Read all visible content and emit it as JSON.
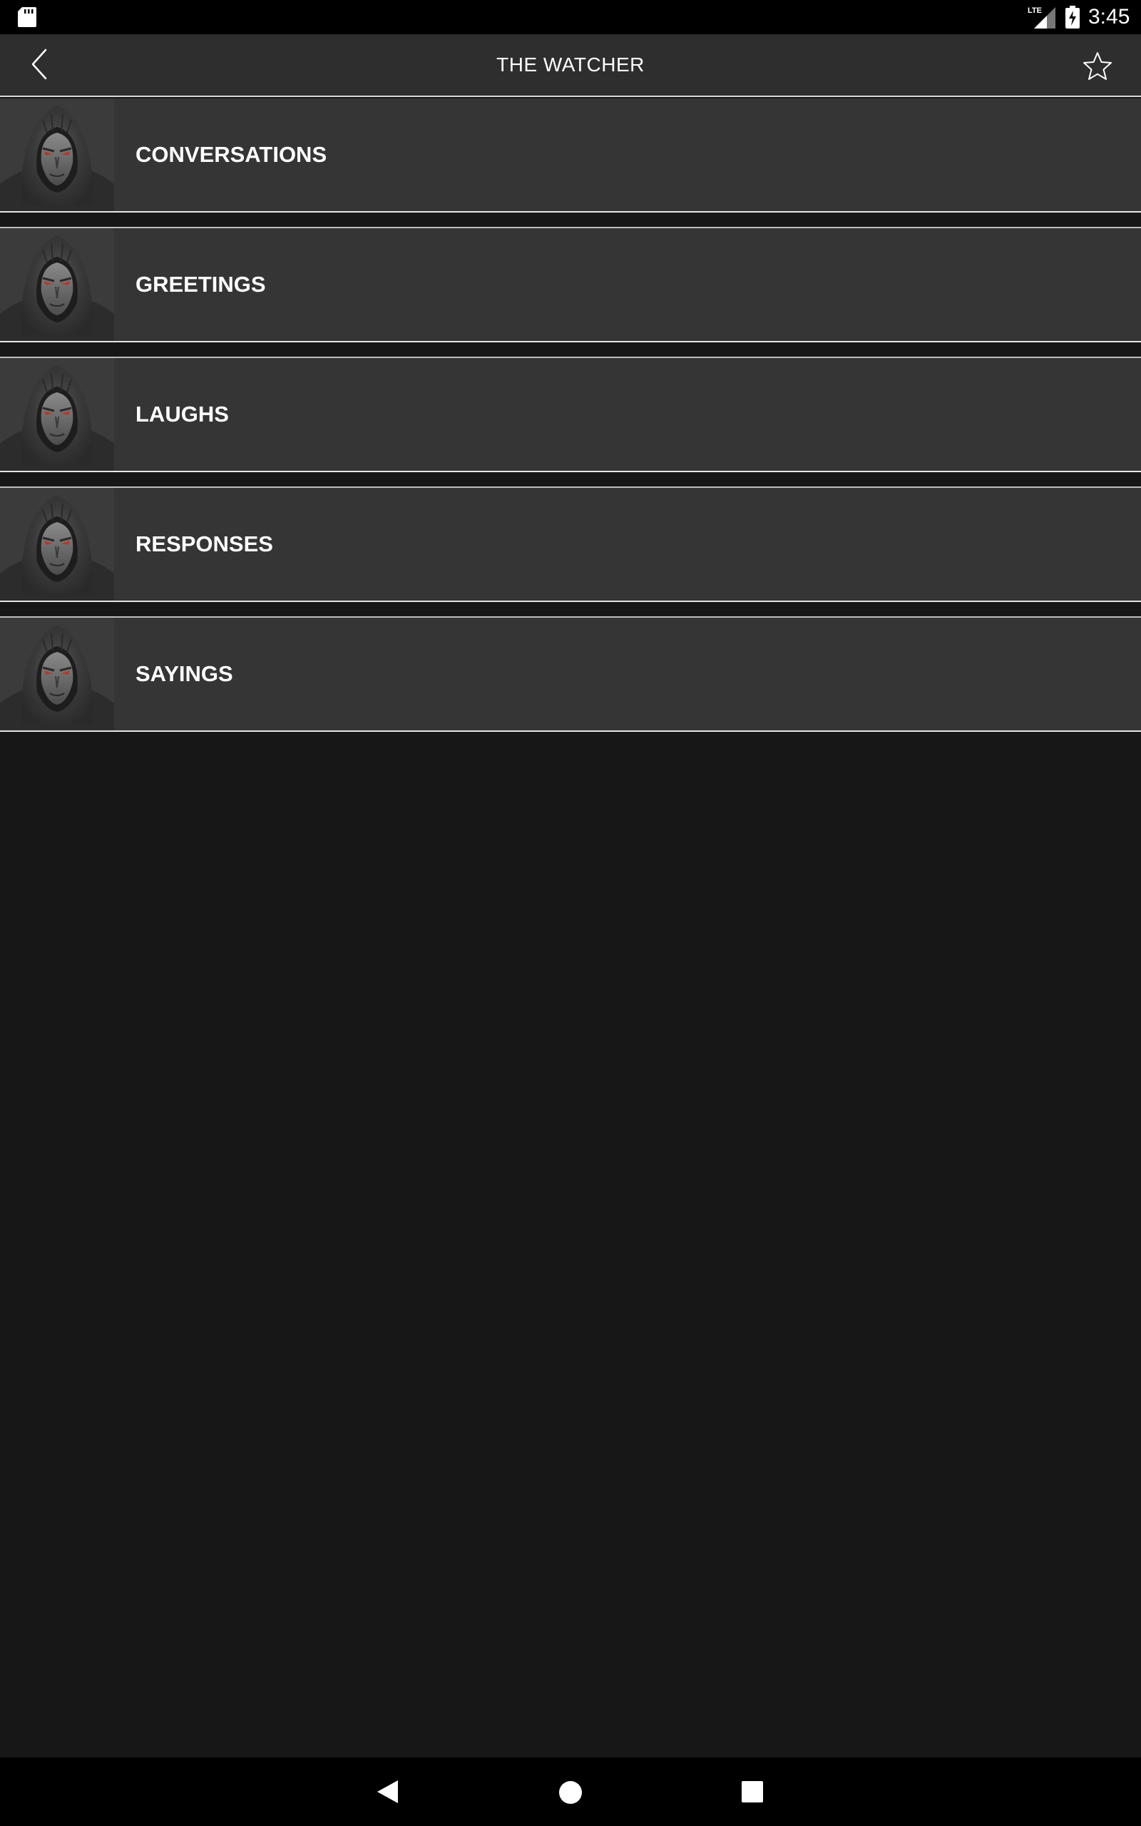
{
  "status_bar": {
    "time": "3:45",
    "network_label": "LTE",
    "icons": [
      "sd-card-icon",
      "lte-signal-icon",
      "battery-charging-icon"
    ]
  },
  "toolbar": {
    "title": "THE WATCHER",
    "back_icon": "chevron-left-icon",
    "favorite_icon": "star-outline-icon"
  },
  "list": {
    "items": [
      {
        "label": "CONVERSATIONS",
        "thumbnail": "hooded-figure-image"
      },
      {
        "label": "GREETINGS",
        "thumbnail": "hooded-figure-image"
      },
      {
        "label": "LAUGHS",
        "thumbnail": "hooded-figure-image"
      },
      {
        "label": "RESPONSES",
        "thumbnail": "hooded-figure-image"
      },
      {
        "label": "SAYINGS",
        "thumbnail": "hooded-figure-image"
      }
    ]
  },
  "nav_bar": {
    "icons": [
      "nav-back-icon",
      "nav-home-icon",
      "nav-recents-icon"
    ]
  },
  "colors": {
    "toolbar": "#2e2e2e",
    "row": "#353535",
    "background": "#171717",
    "divider": "#e6e6e6"
  }
}
